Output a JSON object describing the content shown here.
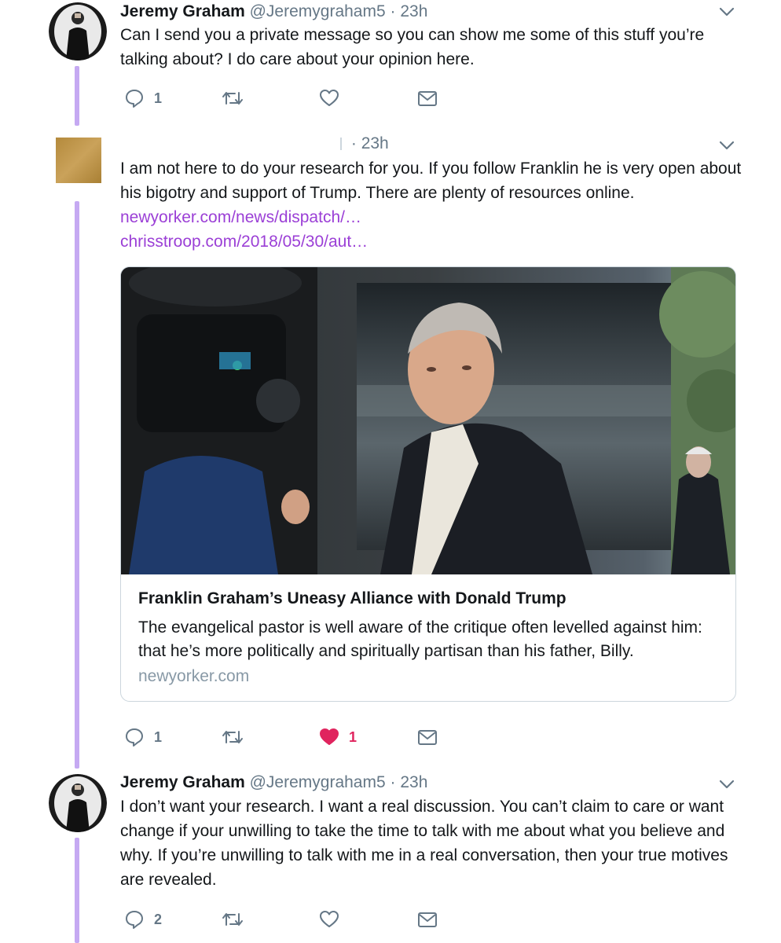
{
  "tweets": [
    {
      "name": "Jeremy Graham",
      "handle": "@Jeremygraham5",
      "separator": "·",
      "time": "23h",
      "text": "Can I send you a private message so you can show me some of this stuff you’re talking about? I do care about your opinion here.",
      "replies": "1",
      "retweets": "",
      "likes": ""
    },
    {
      "name": "",
      "handle": "",
      "separator": "·",
      "time": "23h",
      "text": "I am not here to do your research for you. If you follow Franklin he is very open about his bigotry and support of Trump. There are plenty of resources online.",
      "links": [
        "newyorker.com/news/dispatch/…",
        "chrisstroop.com/2018/05/30/aut…"
      ],
      "card": {
        "title": "Franklin Graham’s Uneasy Alliance with Donald Trump",
        "description": "The evangelical pastor is well aware of the critique often levelled against him: that he’s more politically and spiritually partisan than his father, Billy.",
        "domain": "newyorker.com"
      },
      "replies": "1",
      "retweets": "",
      "likes": "1",
      "liked": true
    },
    {
      "name": "Jeremy Graham",
      "handle": "@Jeremygraham5",
      "separator": "·",
      "time": "23h",
      "text": "I don’t want your research. I want a real discussion. You can’t claim to care or want change if your unwilling to take the time to talk with me about what you believe and why. If you’re unwilling to talk with me in a real conversation, then your true motives are revealed.",
      "replies": "2",
      "retweets": "",
      "likes": ""
    }
  ],
  "colors": {
    "thread_line": "#c5a9f2",
    "link": "#9b3fd6",
    "like_active": "#e0245e",
    "icon_gray": "#657786"
  },
  "icons": [
    "reply-icon",
    "retweet-icon",
    "like-icon",
    "message-icon",
    "chevron-down-icon"
  ]
}
